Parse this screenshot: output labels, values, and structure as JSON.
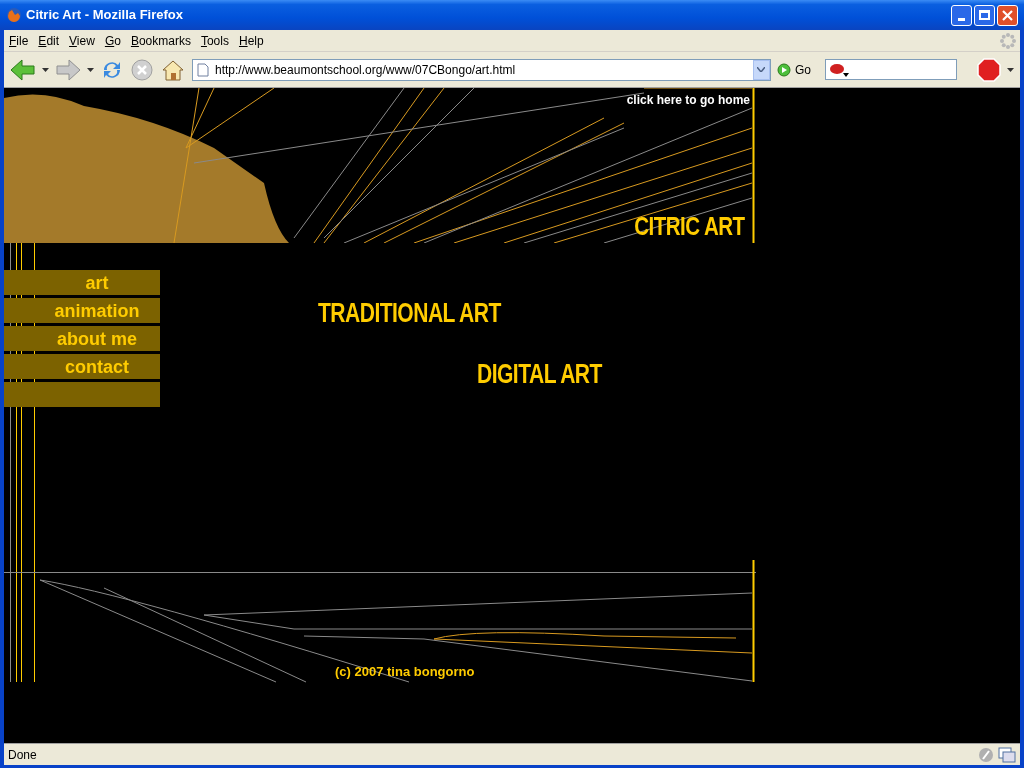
{
  "window": {
    "title": "Citric Art - Mozilla Firefox"
  },
  "menu": [
    {
      "label": "File"
    },
    {
      "label": "Edit"
    },
    {
      "label": "View"
    },
    {
      "label": "Go"
    },
    {
      "label": "Bookmarks"
    },
    {
      "label": "Tools"
    },
    {
      "label": "Help"
    }
  ],
  "toolbar": {
    "address": "http://www.beaumontschool.org/www/07CBongo/art.html",
    "go_label": "Go"
  },
  "page": {
    "home_link": "click here to go home",
    "site_title": "CITRIC ART",
    "nav": [
      {
        "label": "art"
      },
      {
        "label": "animation"
      },
      {
        "label": "about me"
      },
      {
        "label": "contact"
      }
    ],
    "sections": [
      {
        "label": "TRADITIONAL ART"
      },
      {
        "label": "DIGITAL ART"
      }
    ],
    "footer": "(c) 2007 tina bongorno"
  },
  "status_bar": {
    "text": "Done"
  }
}
